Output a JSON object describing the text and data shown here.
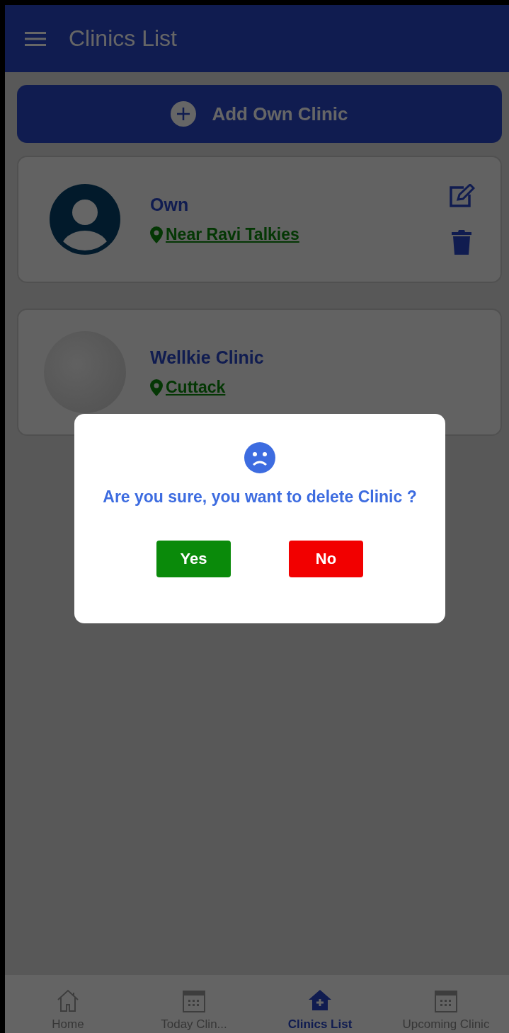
{
  "app_bar": {
    "title": "Clinics List"
  },
  "add_button": {
    "label": "Add Own Clinic"
  },
  "clinics": [
    {
      "kind": "avatar",
      "name": "Own",
      "location": "Near Ravi Talkies",
      "editable": true
    },
    {
      "kind": "photo",
      "name": "Wellkie Clinic",
      "location": "Cuttack",
      "editable": false
    }
  ],
  "dialog": {
    "message": "Are you sure, you want to delete Clinic ?",
    "buttons": [
      {
        "kind": "confirm",
        "label": "Yes"
      },
      {
        "kind": "cancel",
        "label": "No"
      }
    ]
  },
  "bottom_nav": [
    {
      "kind": "home",
      "label": "Home",
      "selected": false
    },
    {
      "kind": "calendar",
      "label": "Today Clin...",
      "selected": false
    },
    {
      "kind": "clinic",
      "label": "Clinics List",
      "selected": true
    },
    {
      "kind": "calendar",
      "label": "Upcoming Clinic",
      "selected": false
    }
  ]
}
